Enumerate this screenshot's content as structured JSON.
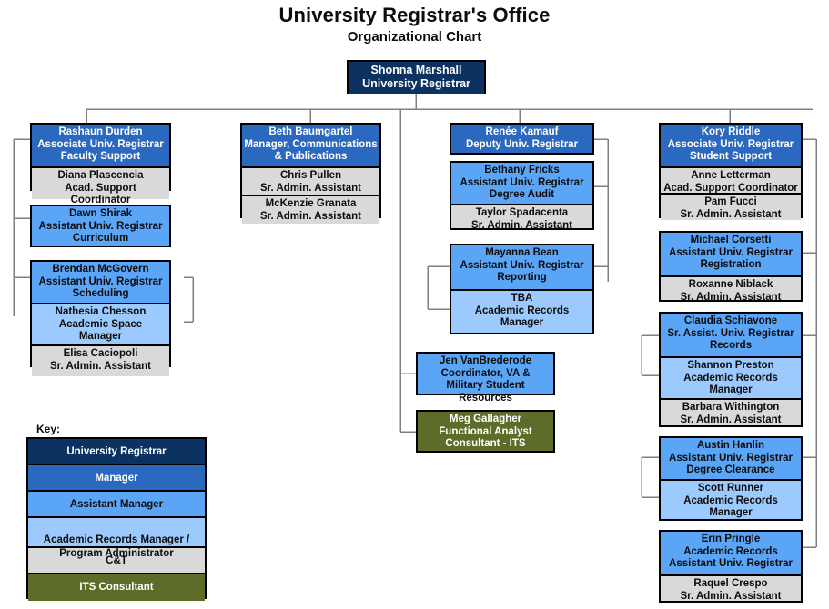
{
  "header": {
    "title": "University Registrar's Office",
    "subtitle": "Organizational Chart"
  },
  "key": {
    "label": "Key:",
    "items": [
      {
        "label": "University Registrar",
        "level": "registrar",
        "color": "#0b3260"
      },
      {
        "label": "Manager",
        "level": "manager",
        "color": "#2b68bf"
      },
      {
        "label": "Assistant Manager",
        "level": "asst",
        "color": "#5ba5f7"
      },
      {
        "label": "Academic Records Manager /\nProgram Administrator",
        "level": "arm",
        "color": "#9ccaff"
      },
      {
        "label": "C&T",
        "level": "ct",
        "color": "#d9d9d9"
      },
      {
        "label": "ITS Consultant",
        "level": "its",
        "color": "#5d6c28"
      }
    ]
  },
  "chart_data": {
    "type": "diagram",
    "title": "University Registrar's Office Organizational Chart",
    "root": {
      "name": "Shonna Marshall",
      "title": "University Registrar",
      "level": "registrar"
    },
    "columns": [
      {
        "id": "faculty-support",
        "nodes": [
          {
            "id": "rashaun-durden",
            "segments": [
              {
                "lines": [
                  "Rashaun Durden",
                  "Associate Univ. Registrar",
                  "Faculty Support"
                ],
                "level": "manager"
              },
              {
                "lines": [
                  "Diana Plascencia",
                  "Acad. Support Coordinator"
                ],
                "level": "ct"
              }
            ]
          },
          {
            "id": "dawn-shirak",
            "segments": [
              {
                "lines": [
                  "Dawn Shirak",
                  "Assistant Univ. Registrar",
                  "Curriculum"
                ],
                "level": "asst"
              }
            ]
          },
          {
            "id": "brendan-mcgovern",
            "segments": [
              {
                "lines": [
                  "Brendan McGovern",
                  "Assistant Univ. Registrar",
                  "Scheduling"
                ],
                "level": "asst"
              },
              {
                "lines": [
                  "Nathesia Chesson",
                  "Academic Space",
                  "Manager"
                ],
                "level": "arm"
              },
              {
                "lines": [
                  "Elisa Caciopoli",
                  "Sr. Admin. Assistant"
                ],
                "level": "ct"
              }
            ]
          }
        ]
      },
      {
        "id": "communications",
        "nodes": [
          {
            "id": "beth-baumgartel",
            "segments": [
              {
                "lines": [
                  "Beth Baumgartel",
                  "Manager, Communications",
                  "& Publications"
                ],
                "level": "manager"
              },
              {
                "lines": [
                  "Chris Pullen",
                  "Sr. Admin. Assistant"
                ],
                "level": "ct"
              },
              {
                "lines": [
                  "McKenzie Granata",
                  "Sr. Admin. Assistant"
                ],
                "level": "ct"
              }
            ]
          }
        ]
      },
      {
        "id": "deputy",
        "nodes": [
          {
            "id": "renee-kamauf",
            "segments": [
              {
                "lines": [
                  "Renée Kamauf",
                  "Deputy Univ. Registrar"
                ],
                "level": "manager"
              }
            ]
          },
          {
            "id": "bethany-fricks",
            "segments": [
              {
                "lines": [
                  "Bethany Fricks",
                  "Assistant Univ. Registrar",
                  "Degree Audit"
                ],
                "level": "asst"
              },
              {
                "lines": [
                  "Taylor Spadacenta",
                  "Sr. Admin. Assistant"
                ],
                "level": "ct"
              }
            ]
          },
          {
            "id": "mayanna-bean",
            "segments": [
              {
                "lines": [
                  "Mayanna Bean",
                  "Assistant Univ. Registrar",
                  "Reporting"
                ],
                "level": "asst"
              },
              {
                "lines": [
                  "TBA",
                  "Academic Records",
                  "Manager"
                ],
                "level": "arm"
              }
            ]
          },
          {
            "id": "jen-vanbrederode",
            "segments": [
              {
                "lines": [
                  "Jen VanBrederode",
                  "Coordinator, VA &",
                  "Military Student Resources"
                ],
                "level": "asst"
              }
            ]
          },
          {
            "id": "meg-gallagher",
            "segments": [
              {
                "lines": [
                  "Meg Gallagher",
                  "Functional Analyst",
                  "Consultant - ITS"
                ],
                "level": "its"
              }
            ]
          }
        ]
      },
      {
        "id": "student-support",
        "nodes": [
          {
            "id": "kory-riddle",
            "segments": [
              {
                "lines": [
                  "Kory Riddle",
                  "Associate Univ. Registrar",
                  "Student Support"
                ],
                "level": "manager"
              },
              {
                "lines": [
                  "Anne Letterman",
                  "Acad. Support Coordinator"
                ],
                "level": "ct"
              },
              {
                "lines": [
                  "Pam Fucci",
                  "Sr. Admin. Assistant"
                ],
                "level": "ct"
              }
            ]
          },
          {
            "id": "michael-corsetti",
            "segments": [
              {
                "lines": [
                  "Michael Corsetti",
                  "Assistant Univ. Registrar",
                  "Registration"
                ],
                "level": "asst"
              },
              {
                "lines": [
                  "Roxanne Niblack",
                  "Sr. Admin. Assistant"
                ],
                "level": "ct"
              }
            ]
          },
          {
            "id": "claudia-schiavone",
            "segments": [
              {
                "lines": [
                  "Claudia Schiavone",
                  "Sr. Assist. Univ. Registrar",
                  "Records"
                ],
                "level": "asst"
              },
              {
                "lines": [
                  "Shannon Preston",
                  "Academic Records",
                  "Manager"
                ],
                "level": "arm"
              },
              {
                "lines": [
                  "Barbara Withington",
                  "Sr. Admin. Assistant"
                ],
                "level": "ct"
              }
            ]
          },
          {
            "id": "austin-hanlin",
            "segments": [
              {
                "lines": [
                  "Austin Hanlin",
                  "Assistant Univ. Registrar",
                  "Degree Clearance"
                ],
                "level": "asst"
              },
              {
                "lines": [
                  "Scott Runner",
                  "Academic Records",
                  "Manager"
                ],
                "level": "arm"
              }
            ]
          },
          {
            "id": "erin-pringle",
            "segments": [
              {
                "lines": [
                  "Erin Pringle",
                  "Academic Records",
                  "Assistant Univ. Registrar"
                ],
                "level": "asst"
              },
              {
                "lines": [
                  "Raquel Crespo",
                  "Sr. Admin. Assistant"
                ],
                "level": "ct"
              }
            ]
          }
        ]
      }
    ]
  }
}
